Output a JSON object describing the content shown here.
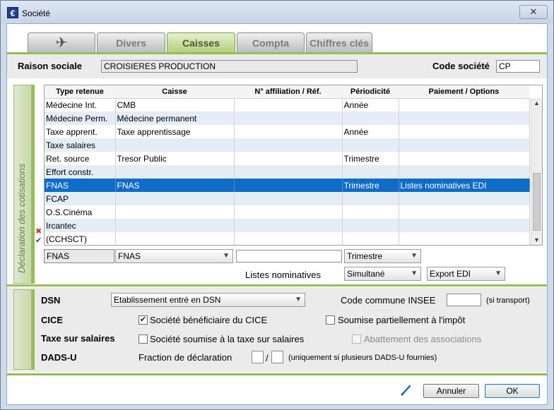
{
  "window": {
    "title": "Société",
    "close_symbol": "✕"
  },
  "tabs": [
    {
      "label": "✈",
      "icon": "airplane-icon",
      "active": false
    },
    {
      "label": "Divers",
      "active": false
    },
    {
      "label": "Caisses",
      "active": true
    },
    {
      "label": "Compta",
      "active": false
    },
    {
      "label": "Chiffres clés",
      "active": false
    }
  ],
  "header": {
    "raison_label": "Raison sociale",
    "raison_value": "CROISIERES PRODUCTION",
    "code_label": "Code société",
    "code_value": "CP"
  },
  "side_title": "Déclaration des cotisations",
  "grid": {
    "columns": [
      "Type retenue",
      "Caisse",
      "N° affiliation / Réf.",
      "Périodicité",
      "Paiement / Options"
    ],
    "rows": [
      [
        "Médecine Int.",
        "CMB",
        "",
        "Année",
        ""
      ],
      [
        "Médecine Perm.",
        "Médecine permanent",
        "",
        "",
        ""
      ],
      [
        "Taxe apprent.",
        "Taxe apprentissage",
        "",
        "Année",
        ""
      ],
      [
        "Taxe salaires",
        "",
        "",
        "",
        ""
      ],
      [
        "Ret. source",
        "Tresor Public",
        "",
        "Trimestre",
        ""
      ],
      [
        "Effort constr.",
        "",
        "",
        "",
        ""
      ],
      [
        "FNAS",
        "FNAS",
        "",
        "Trimestre",
        "Listes nominatives EDI"
      ],
      [
        "FCAP",
        "",
        "",
        "",
        ""
      ],
      [
        "O.S.Cinéma",
        "",
        "",
        "",
        ""
      ],
      [
        "Ircantec",
        "",
        "",
        "",
        ""
      ],
      [
        "(CCHSCT)",
        "",
        "",
        "",
        ""
      ]
    ],
    "selected_row": 6,
    "marks": {
      "x": "✖",
      "check": "✔"
    }
  },
  "editor": {
    "type_value": "FNAS",
    "caisse_value": "FNAS",
    "affiliation_value": "",
    "periodicite_value": "Trimestre",
    "listes_label": "Listes nominatives",
    "listes_value": "Simultané",
    "export_value": "Export EDI"
  },
  "settings": {
    "dsn_label": "DSN",
    "dsn_value": "Etablissement entré en DSN",
    "insee_label": "Code commune INSEE",
    "insee_value": "",
    "insee_note": "(si transport)",
    "cice_label": "CICE",
    "cice_check1_label": "Société bénéficiaire du CICE",
    "cice_check1_checked": true,
    "cice_check2_label": "Soumise partiellement à l'impôt",
    "cice_check2_checked": false,
    "taxe_label": "Taxe sur salaires",
    "taxe_check1_label": "Société soumise à la taxe sur salaires",
    "taxe_check1_checked": false,
    "taxe_check2_label": "Abattement des associations",
    "taxe_check2_checked": false,
    "dads_label": "DADS-U",
    "fraction_label": "Fraction de déclaration",
    "fraction_sep": "/",
    "fraction_note": "(uniquement si plusieurs DADS-U fournies)"
  },
  "footer": {
    "pen_icon": "pen-icon",
    "cancel_label": "Annuler",
    "ok_label": "OK"
  },
  "colors": {
    "accent_green": "#93bf55",
    "selection_blue": "#0f6cc7",
    "alt_row": "#e4ecf6"
  }
}
